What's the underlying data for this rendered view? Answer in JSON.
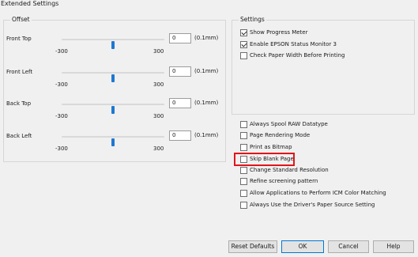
{
  "window": {
    "title": "Extended Settings"
  },
  "offset": {
    "label": "Offset",
    "sliders": [
      {
        "label": "Front Top",
        "value": "0",
        "unit": "(0.1mm)",
        "min": "-300",
        "max": "300",
        "level": 0.5
      },
      {
        "label": "Front Left",
        "value": "0",
        "unit": "(0.1mm)",
        "min": "-300",
        "max": "300",
        "level": 0.5
      },
      {
        "label": "Back Top",
        "value": "0",
        "unit": "(0.1mm)",
        "min": "-300",
        "max": "300",
        "level": 0.5
      },
      {
        "label": "Back Left",
        "value": "0",
        "unit": "(0.1mm)",
        "min": "-300",
        "max": "300",
        "level": 0.5
      }
    ]
  },
  "settings": {
    "label": "Settings",
    "top_options": [
      {
        "label": "Show Progress Meter",
        "checked": true
      },
      {
        "label": "Enable EPSON Status Monitor 3",
        "checked": true
      },
      {
        "label": "Check Paper Width Before Printing",
        "checked": false
      }
    ],
    "bottom_options": [
      {
        "label": "Always Spool RAW Datatype",
        "checked": false
      },
      {
        "label": "Page Rendering Mode",
        "checked": false
      },
      {
        "label": "Print as Bitmap",
        "checked": false
      },
      {
        "label": "Skip Blank Page",
        "checked": false
      },
      {
        "label": "Change Standard Resolution",
        "checked": false
      },
      {
        "label": "Refine screening pattern",
        "checked": false
      },
      {
        "label": "Allow Applications to Perform ICM Color Matching",
        "checked": false
      },
      {
        "label": "Always Use the Driver's Paper Source Setting",
        "checked": false
      }
    ]
  },
  "buttons": {
    "reset": "Reset Defaults",
    "ok": "OK",
    "cancel": "Cancel",
    "help": "Help"
  },
  "colors": {
    "accent": "#1e78d2",
    "highlight": "#e1151b"
  }
}
